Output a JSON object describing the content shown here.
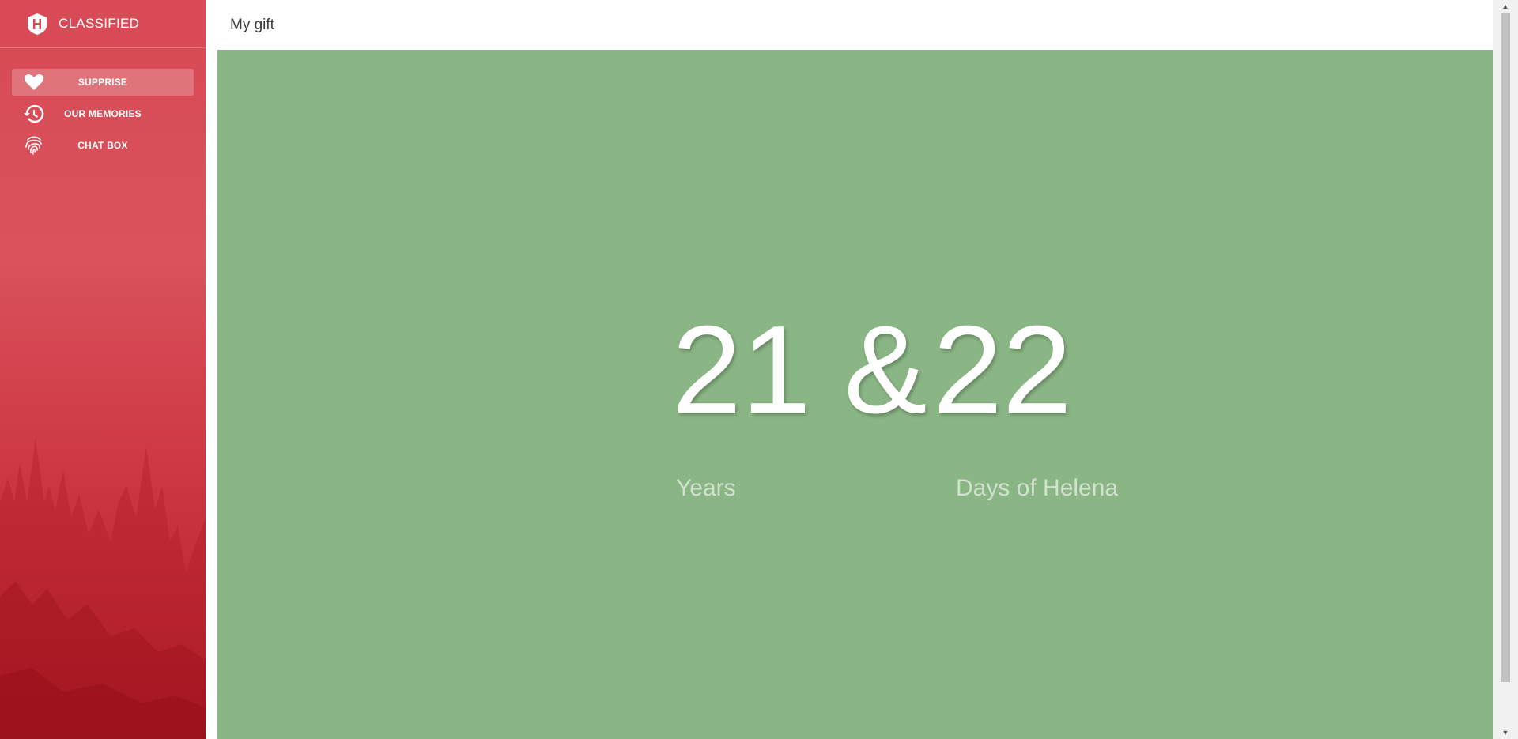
{
  "sidebar": {
    "brand": {
      "name": "CLASSIFIED",
      "icon": "shield-h-logo"
    },
    "items": [
      {
        "label": "SUPPRISE",
        "icon": "heart-icon",
        "active": true
      },
      {
        "label": "OUR MEMORIES",
        "icon": "history-icon",
        "active": false
      },
      {
        "label": "CHAT BOX",
        "icon": "fingerprint-icon",
        "active": false
      }
    ]
  },
  "header": {
    "title": "My gift"
  },
  "main": {
    "years_value": "21",
    "separator": "&",
    "days_value": "22",
    "years_label": "Years",
    "days_label": "Days of Helena",
    "background": "#8ab584"
  },
  "colors": {
    "sidebar_accent": "#d84a55",
    "text_on_dark": "#ffffff"
  }
}
